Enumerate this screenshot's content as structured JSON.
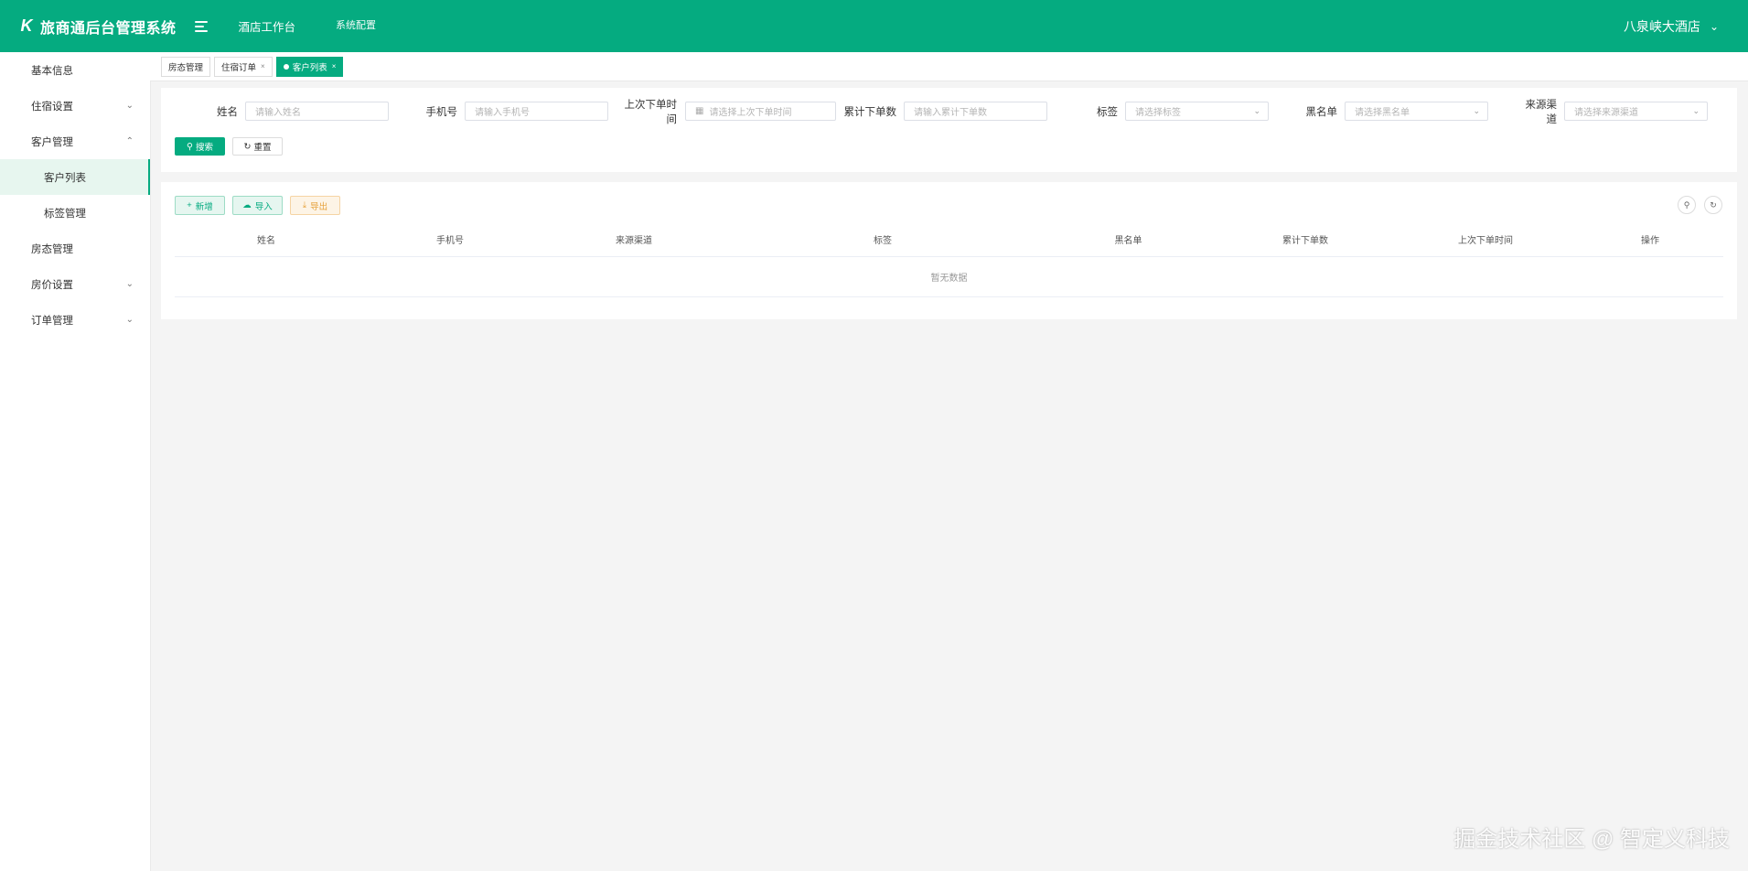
{
  "header": {
    "logo_glyph": "K",
    "title": "旅商通后台管理系统",
    "nav": [
      "酒店工作台",
      "系统配置"
    ],
    "hotel_name": "八泉峡大酒店",
    "brand_color": "#05ab80"
  },
  "sidebar": {
    "items": [
      {
        "label": "基本信息"
      },
      {
        "label": "住宿设置"
      },
      {
        "label": "客户管理"
      },
      {
        "label": "客户列表"
      },
      {
        "label": "标签管理"
      },
      {
        "label": "房态管理"
      },
      {
        "label": "房价设置"
      },
      {
        "label": "订单管理"
      }
    ]
  },
  "tabs": [
    {
      "label": "房态管理"
    },
    {
      "label": "住宿订单"
    },
    {
      "label": "客户列表"
    }
  ],
  "search": {
    "fields": [
      {
        "label": "姓名",
        "placeholder": "请输入姓名"
      },
      {
        "label": "手机号",
        "placeholder": "请输入手机号"
      },
      {
        "label": "上次下单时间",
        "placeholder": "请选择上次下单时间"
      },
      {
        "label": "累计下单数",
        "placeholder": "请输入累计下单数"
      },
      {
        "label": "标签",
        "placeholder": "请选择标签"
      },
      {
        "label": "黑名单",
        "placeholder": "请选择黑名单"
      },
      {
        "label": "来源渠道",
        "placeholder": "请选择来源渠道"
      }
    ],
    "search_label": "搜索",
    "reset_label": "重置"
  },
  "table": {
    "add_label": "新增",
    "import_label": "导入",
    "export_label": "导出",
    "columns": [
      "姓名",
      "手机号",
      "来源渠道",
      "标签",
      "黑名单",
      "累计下单数",
      "上次下单时间",
      "操作"
    ],
    "empty_text": "暂无数据"
  },
  "watermark": "掘金技术社区 @ 智定义科技"
}
